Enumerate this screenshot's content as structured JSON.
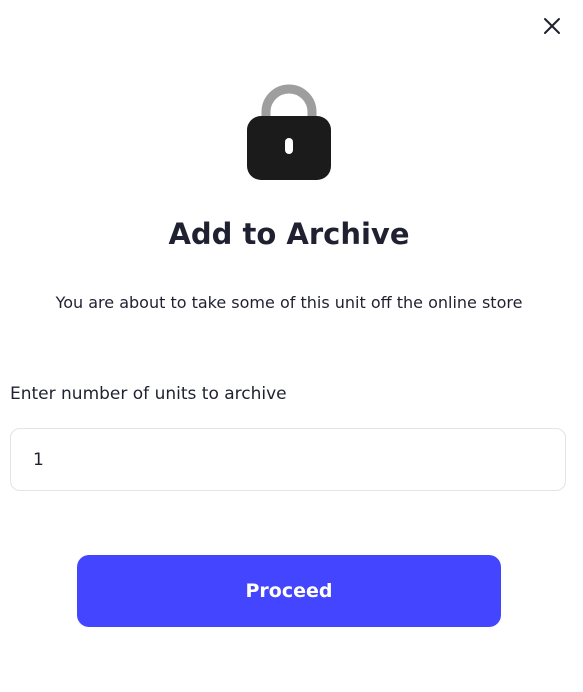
{
  "dialog": {
    "close_icon": "close-icon",
    "lock_icon": "lock-icon",
    "title": "Add to Archive",
    "subtitle": "You are about to take some of this unit off the online store",
    "field_label": "Enter number of units to archive",
    "units_value": "1",
    "proceed_label": "Proceed"
  },
  "colors": {
    "primary": "#4446ff",
    "text": "#1f2130",
    "lock_body": "#1b1b1b",
    "lock_shackle": "#9e9e9e",
    "input_border": "#e3e3e8"
  }
}
